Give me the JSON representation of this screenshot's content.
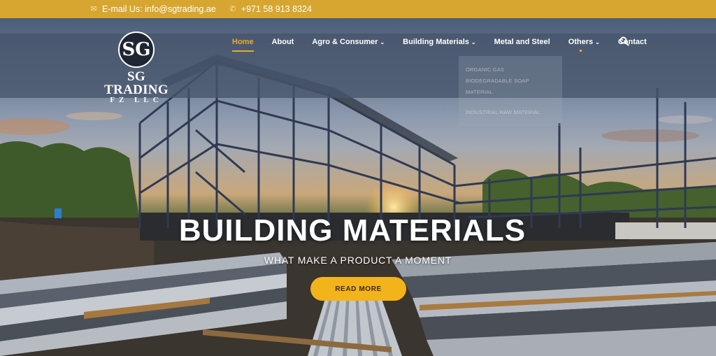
{
  "topbar": {
    "email_label": "E-mail Us: info@sgtrading.ae",
    "phone_label": "+971 58 913 8324"
  },
  "logo": {
    "monogram": "SG",
    "name": "SG TRADING",
    "sub": "FZ LLC"
  },
  "nav": {
    "items": [
      {
        "label": "Home",
        "caret": false,
        "active": true
      },
      {
        "label": "About",
        "caret": false
      },
      {
        "label": "Agro & Consumer",
        "caret": true
      },
      {
        "label": "Building Materials",
        "caret": true
      },
      {
        "label": "Metal and Steel",
        "caret": false
      },
      {
        "label": "Others",
        "caret": true
      },
      {
        "label": "Contact",
        "caret": false
      }
    ],
    "search_icon": "search-icon",
    "caret_glyph": "⌄"
  },
  "dropdown": {
    "items": [
      "ORGANIC GAS",
      "BIODEGRADABLE SOAP",
      "MATERIAL",
      "INDUSTRIAL RAW MATERIAL"
    ]
  },
  "hero": {
    "headline": "BUILDING MATERIALS",
    "subline": "WHAT MAKE A PRODUCT A MOMENT",
    "button_label": "READ MORE"
  },
  "colors": {
    "accent": "#e6ad2b",
    "topbar": "#d6a630",
    "button": "#f3b31a"
  }
}
